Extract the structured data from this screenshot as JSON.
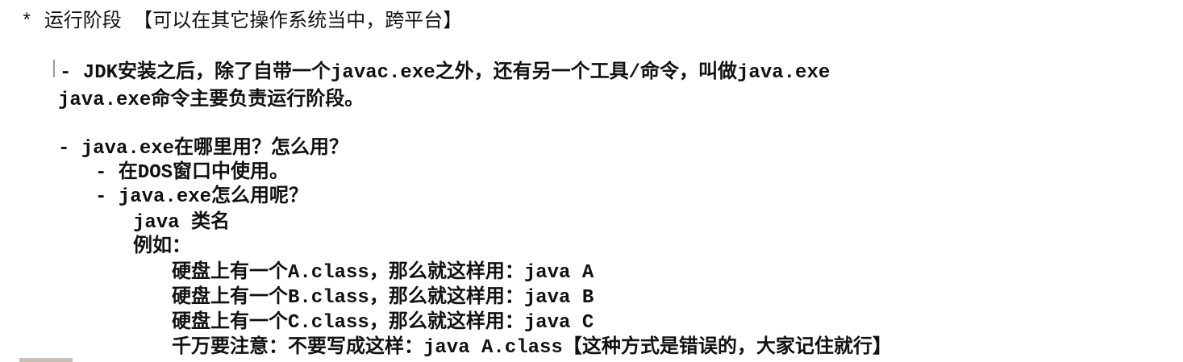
{
  "lines": [
    {
      "text": "* 运行阶段 【可以在其它操作系统当中，跨平台】"
    },
    {
      "text": "- JDK安装之后，除了自带一个javac.exe之外，还有另一个工具/命令，叫做java.exe"
    },
    {
      "text": "java.exe命令主要负责运行阶段。"
    },
    {
      "text": "- java.exe在哪里用？怎么用？"
    },
    {
      "text": "- 在DOS窗口中使用。"
    },
    {
      "text": "- java.exe怎么用呢？"
    },
    {
      "text": "java 类名"
    },
    {
      "text": "例如："
    },
    {
      "text": "硬盘上有一个A.class，那么就这样用：java A"
    },
    {
      "text": "硬盘上有一个B.class，那么就这样用：java B"
    },
    {
      "text": "硬盘上有一个C.class，那么就这样用：java C"
    },
    {
      "text": "千万要注意：不要写成这样：java A.class【这种方式是错误的，大家记住就行】"
    }
  ]
}
